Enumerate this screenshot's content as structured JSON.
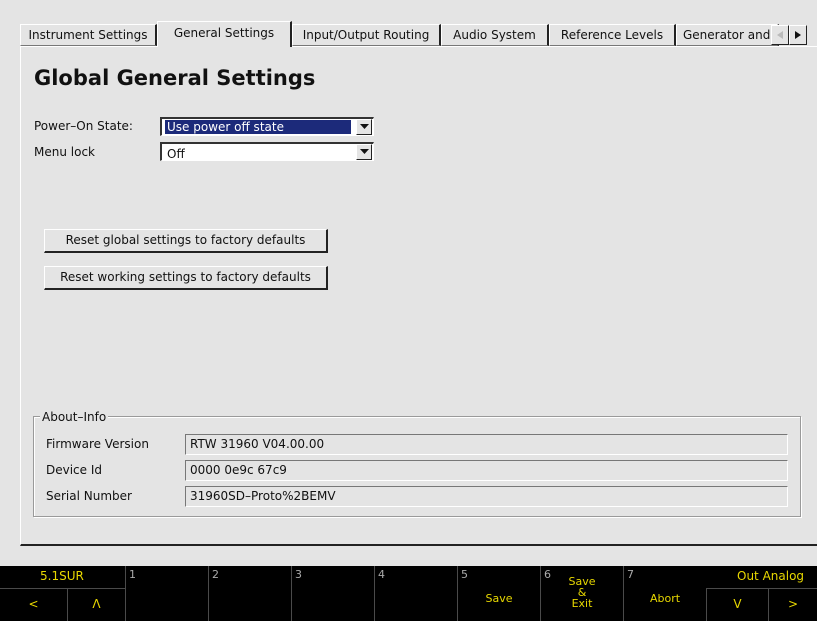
{
  "tabs": [
    {
      "label": "Instrument Settings"
    },
    {
      "label": "General Settings"
    },
    {
      "label": "Input/Output Routing"
    },
    {
      "label": "Audio System"
    },
    {
      "label": "Reference Levels"
    },
    {
      "label": "Generator and S"
    }
  ],
  "active_tab": "General Settings",
  "scroll_icons": {
    "left": "triangle-left-icon",
    "right": "triangle-right-icon"
  },
  "page_title": "Global General Settings",
  "fields": {
    "power_on": {
      "label": "Power–On State:",
      "value": "Use power off state"
    },
    "menu_lock": {
      "label": "Menu lock",
      "value": "Off"
    }
  },
  "buttons": {
    "reset_global": "Reset global settings to factory defaults",
    "reset_working": "Reset working settings to factory defaults"
  },
  "about": {
    "title": "About–Info",
    "rows": [
      {
        "label": "Firmware Version",
        "value": "RTW 31960 V04.00.00"
      },
      {
        "label": "Device Id",
        "value": "0000 0e9c 67c9"
      },
      {
        "label": "Serial Number",
        "value": "31960SD–Proto%2BEMV"
      }
    ]
  },
  "softkeys": {
    "top_left_label": "5.1SUR",
    "top_right_label": "Out Analog",
    "left_btn": "<",
    "up_btn": "Λ",
    "down_btn": "V",
    "right_btn": ">",
    "keys": [
      {
        "num": "1",
        "label": ""
      },
      {
        "num": "2",
        "label": ""
      },
      {
        "num": "3",
        "label": ""
      },
      {
        "num": "4",
        "label": ""
      },
      {
        "num": "5",
        "label": "Save"
      },
      {
        "num": "6",
        "label": "Save\n&\nExit"
      },
      {
        "num": "7",
        "label": "Abort"
      }
    ]
  },
  "colors": {
    "accent": "#1c2a7a",
    "softkey_text": "#e8d800",
    "panel_bg": "#e4e4e4"
  }
}
